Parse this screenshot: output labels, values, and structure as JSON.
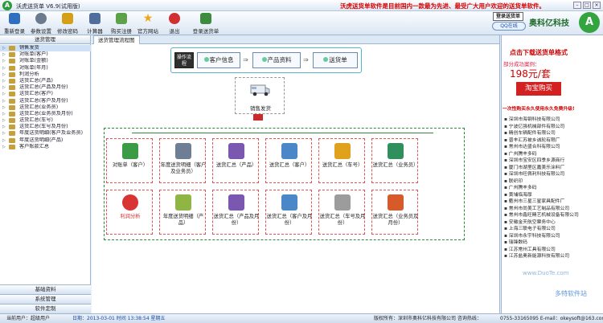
{
  "window": {
    "title": "沃虎送货单 V6.9(试用版)",
    "banner": "沃虎送货单软件是目前国内一款最为先进、最受广大用户欢迎的送货单软件。"
  },
  "toolbar": {
    "items": [
      {
        "label": "重新登录",
        "icon": "relogin-icon",
        "color": "#2f6fbf"
      },
      {
        "label": "参数设置",
        "icon": "settings-icon",
        "color": "#6b7b8d"
      },
      {
        "label": "修改密码",
        "icon": "key-icon",
        "color": "#d4a016"
      },
      {
        "label": "计算器",
        "icon": "calculator-icon",
        "color": "#4f6e9c"
      },
      {
        "label": "购买注册",
        "icon": "cart-icon",
        "color": "#5fa14a"
      },
      {
        "label": "官方网站",
        "icon": "star-icon",
        "color": "#f0a512"
      },
      {
        "label": "退出",
        "icon": "exit-icon",
        "color": "#d03030"
      },
      {
        "label": "登录送货单",
        "icon": "login-icon",
        "color": "#3d8b3d"
      }
    ],
    "login_label": "登录送货单",
    "qq_label": "QQ在线",
    "brand": "奥科亿科技"
  },
  "sidebar": {
    "header": "送货管理",
    "items": [
      "销售发货",
      "对账单(客户)",
      "对账单(金额)",
      "对账单(年月)",
      "利润分析",
      "送货汇总(产品)",
      "送货汇总(产品及月份)",
      "送货汇总(客户)",
      "送货汇总(客户及月份)",
      "送货汇总(业务员)",
      "送货汇总(业务员及月份)",
      "送货汇总(车号)",
      "送货汇总(车号及月份)",
      "年度送货明细(客户及业务员)",
      "年度送货明细(产品)",
      "客户账款汇总"
    ],
    "sections": [
      "基础资料",
      "系统管理",
      "软件定制"
    ]
  },
  "main": {
    "tab": "送货管理流程图",
    "flow": {
      "op": "操作流程",
      "step1": "客户信息",
      "step2": "产品资料",
      "step3": "送货单"
    },
    "sales": "销售发货",
    "row1": [
      {
        "label": "对账单（客户）",
        "color": "#3b9c45"
      },
      {
        "label": "年度送货明细（客户及业务员）",
        "color": "#6e7f95"
      },
      {
        "label": "送货汇总（产品）",
        "color": "#7a58b0"
      },
      {
        "label": "送货汇总（客户）",
        "color": "#4a87c9"
      },
      {
        "label": "送货汇总（车号）",
        "color": "#e0a21d"
      },
      {
        "label": "送货汇总（业务员）",
        "color": "#2f8f5d"
      }
    ],
    "row2": [
      {
        "label": "利润分析",
        "color": "#d83434",
        "red": true
      },
      {
        "label": "年度送货明细（产品）",
        "color": "#8fb544"
      },
      {
        "label": "送货汇总（产品及月份）",
        "color": "#7a58b0"
      },
      {
        "label": "送货汇总（客户及月份）",
        "color": "#4a87c9"
      },
      {
        "label": "送货汇总（车号及月份）",
        "color": "#9c9c9c"
      },
      {
        "label": "送货汇总（业务员及月份）",
        "color": "#d65a2a"
      }
    ]
  },
  "ad": {
    "title": "点击下载送货单格式",
    "version": "部分成功案例：",
    "price": "198元/套",
    "buy": "淘宝购买",
    "note": "一次性购买永久使用永久免费升级!",
    "clients": [
      "深圳市海钢科技有限公司",
      "宁波亿强机械部件有限公司",
      "精创车辆配件有限公司",
      "晋丰汇苏被乡诚轮有限厂",
      "常州市达盛合科有限公司",
      "广州腾丰多码",
      "深圳市宝安区四季乡源商行",
      "厦门市湖里区嘉美乐涂料厂",
      "深圳市旺佩利科技有限公司",
      "联织印",
      "广州腾丰多码",
      "黄埔临海厚",
      "衢州市三星三星家具配件厂",
      "常州市尚美工艺制品有限公司",
      "常州市鑫旺精艺机械设备有限公司",
      "安徽金天航空票务中心",
      "上海三联电子有限公司",
      "深圳市永宇科技有限公司",
      "瑞锋数码",
      "江苏常州工具有限公司",
      "江苏盐奥新能源科技有限公司"
    ]
  },
  "status": {
    "user": "当前用户：超级用户",
    "date": "日期：2013-03-01  时间 13:38:54 星期五",
    "copyright": "版权所有：深圳市奥科亿科技有限公司  咨询热线：",
    "phone": "0755-33165095  E-mail：okeysoft@163.com"
  },
  "watermarks": {
    "a": "www.DuoTe.com",
    "b": "多特软件站"
  }
}
